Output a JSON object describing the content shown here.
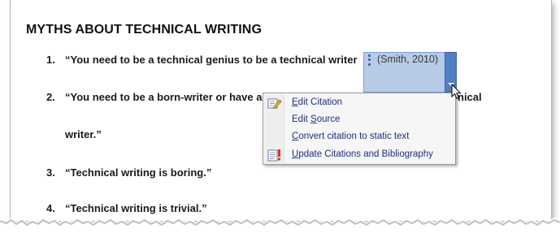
{
  "document": {
    "heading": "MYTHS ABOUT TECHNICAL WRITING",
    "items": [
      {
        "number": "1.",
        "text": "“You need to be a technical genius to be a technical writer"
      },
      {
        "number": "2.",
        "text_before": "“You need to be a born-writer  or have a",
        "text_after": "nical",
        "continuation": "writer.”"
      },
      {
        "number": "3.",
        "text": "“Technical writing is boring.”"
      },
      {
        "number": "4.",
        "text": "“Technical writing is trivial.”"
      }
    ]
  },
  "citation": {
    "text": "(Smith, 2010)",
    "dropdown_icon": "chevron-down-icon",
    "accent_color": "#4f7fc4",
    "fill_color": "#b8cbe6"
  },
  "context_menu": {
    "items": [
      {
        "pre": "",
        "key": "E",
        "post": "dit Citation",
        "icon": "edit-citation-icon"
      },
      {
        "pre": "Edit ",
        "key": "S",
        "post": "ource",
        "icon": ""
      },
      {
        "pre": "",
        "key": "C",
        "post": "onvert citation to static text",
        "icon": ""
      },
      {
        "pre": "",
        "key": "U",
        "post": "pdate Citations and Bibliography",
        "icon": "update-bibliography-icon"
      }
    ],
    "label_color": "#1e2f7a"
  }
}
